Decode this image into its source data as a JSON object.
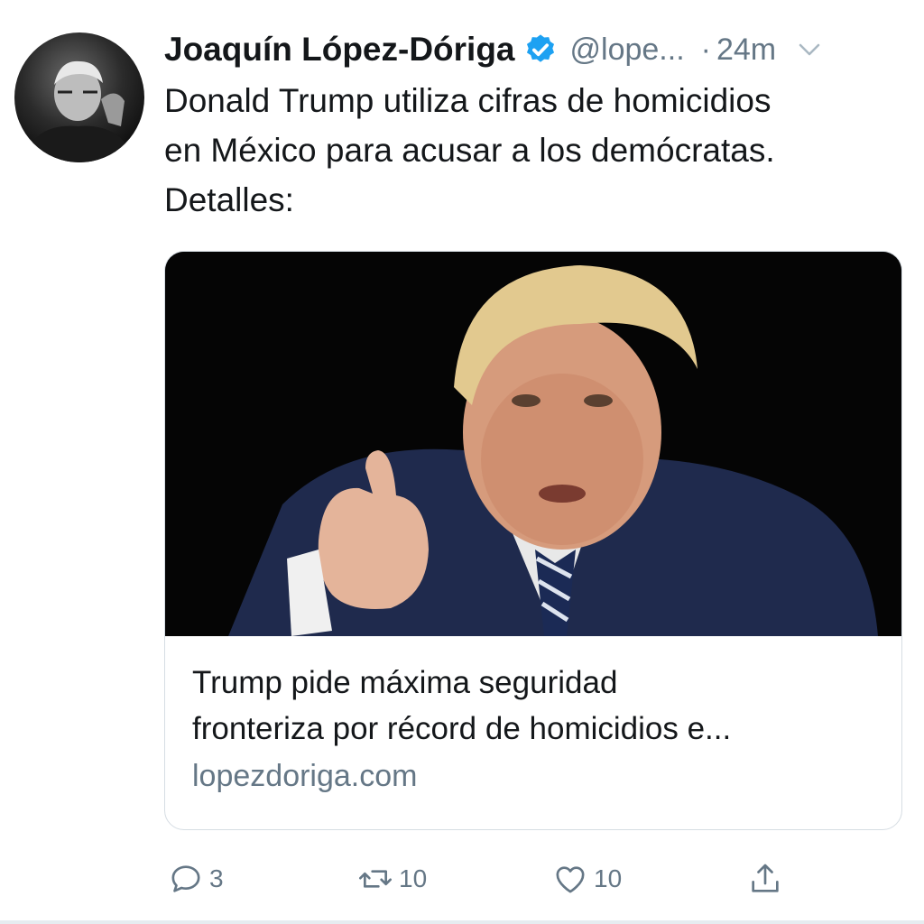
{
  "tweet": {
    "author_name": "Joaquín López-Dóriga",
    "handle": "@lope...",
    "separator": "·",
    "time": "24m",
    "text": "Donald Trump utiliza cifras de homicidios\nen México para acusar a los demócratas.\nDetalles:"
  },
  "card": {
    "title_line1": "Trump pide máxima seguridad",
    "title_line2": "fronteriza por récord de homicidios e...",
    "domain": "lopezdoriga.com"
  },
  "actions": {
    "reply_count": "3",
    "retweet_count": "10",
    "like_count": "10"
  },
  "colors": {
    "verified": "#1da1f2",
    "secondary_text": "#657786",
    "border": "#d6dde3"
  },
  "icons": {
    "verified": "verified-badge-icon",
    "more": "chevron-down-icon",
    "reply": "reply-icon",
    "retweet": "retweet-icon",
    "like": "heart-icon",
    "share": "share-icon"
  }
}
